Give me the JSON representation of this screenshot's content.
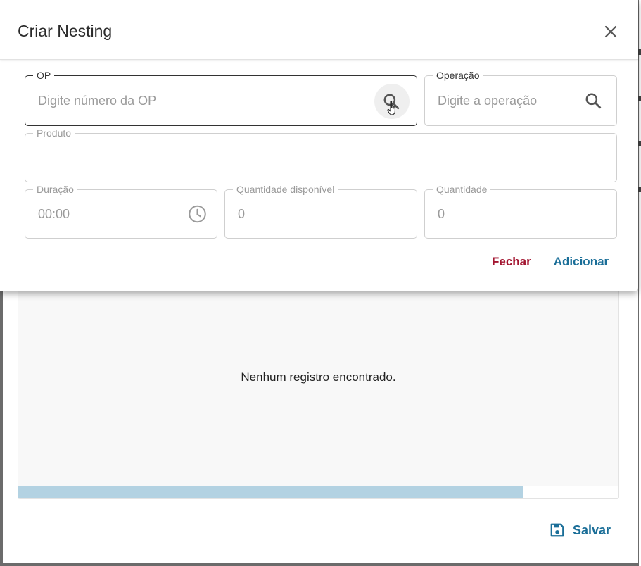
{
  "dialog": {
    "title": "Criar Nesting",
    "fields": {
      "op": {
        "label": "OP",
        "placeholder": "Digite número da OP",
        "value": ""
      },
      "operacao": {
        "label": "Operação",
        "placeholder": "Digite a operação",
        "value": ""
      },
      "produto": {
        "label": "Produto",
        "value": ""
      },
      "duracao": {
        "label": "Duração",
        "placeholder": "00:00",
        "value": ""
      },
      "quantidade_disponivel": {
        "label": "Quantidade disponível",
        "placeholder": "0",
        "value": ""
      },
      "quantidade": {
        "label": "Quantidade",
        "placeholder": "0",
        "value": ""
      }
    },
    "actions": {
      "close_label": "Fechar",
      "add_label": "Adicionar"
    }
  },
  "table": {
    "empty_message": "Nenhum registro encontrado.",
    "progress": 0.84
  },
  "footer": {
    "save_label": "Salvar"
  },
  "colors": {
    "accent": "#1a6e98",
    "danger": "#a31530",
    "progress": "#b3d2e2"
  }
}
